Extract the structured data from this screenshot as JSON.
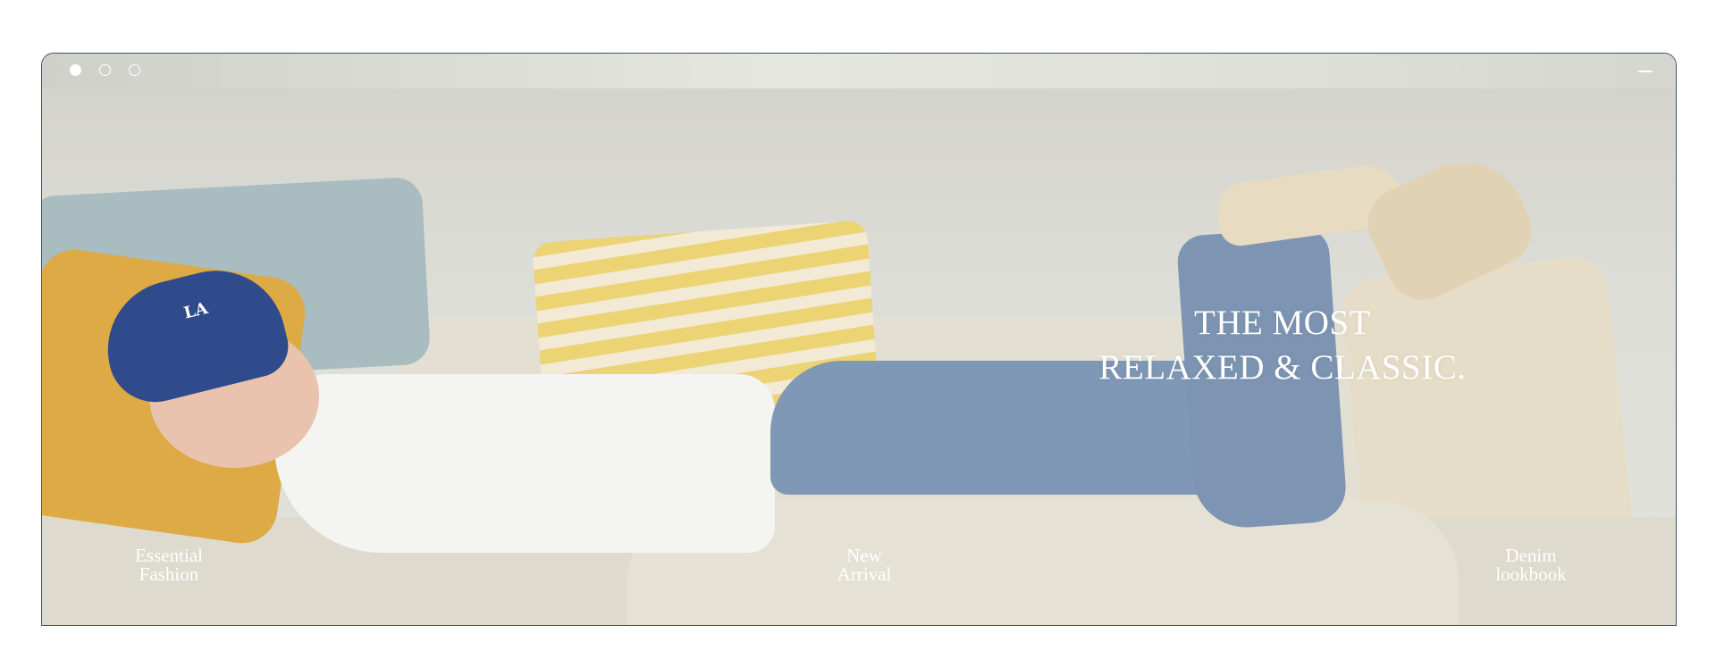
{
  "window": {
    "controls": [
      "close-dot",
      "minimize-dot",
      "maximize-dot"
    ]
  },
  "hero": {
    "headline_line1": "THE MOST",
    "headline_line2": "RELAXED & CLASSIC.",
    "cap_logo": "LA"
  },
  "nav": [
    {
      "line1": "Essential",
      "line2": "Fashion"
    },
    {
      "line1": "New",
      "line2": "Arrival"
    },
    {
      "line1": "Denim",
      "line2": "lookbook"
    }
  ],
  "colors": {
    "frame_border": "#3a5568",
    "text": "#ffffff",
    "cap": "#2f4b8c",
    "denim": "#7f98b5"
  }
}
